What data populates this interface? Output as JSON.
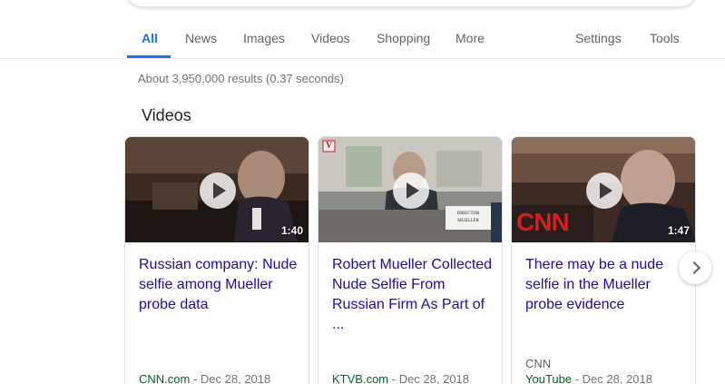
{
  "tabs": {
    "all": "All",
    "news": "News",
    "images": "Images",
    "videos": "Videos",
    "shopping": "Shopping",
    "more": "More",
    "settings": "Settings",
    "tools": "Tools",
    "active_color": "#1a73e8"
  },
  "result_stats": "About 3,950,000 results (0.37 seconds)",
  "videos_section": {
    "title": "Videos",
    "cards": [
      {
        "title": "Russian company: Nude selfie among Mueller probe data",
        "duration": "1:40",
        "publisher": "",
        "source": "CNN.com",
        "separator": " - ",
        "date": "Dec 28, 2018"
      },
      {
        "title": "Robert Mueller Collected Nude Selfie From Russian Firm As Part of ...",
        "duration": "",
        "overlay_logo": "V",
        "nameplate_line1": "DIRECTOR",
        "nameplate_line2": "MUELLER",
        "publisher": "",
        "source": "KTVB.com",
        "separator": " - ",
        "date": "Dec 28, 2018"
      },
      {
        "title": "There may be a nude selfie in the Mueller probe evidence",
        "duration": "1:47",
        "overlay_logo": "CNN",
        "publisher": "CNN",
        "source": "YouTube",
        "separator": " - ",
        "date": "Dec 28, 2018"
      }
    ]
  },
  "colors": {
    "link_title": "#1a0dab",
    "source_green": "#006621",
    "meta_gray": "#70757a"
  },
  "icons": {
    "play": "play-icon",
    "next": "chevron-right-icon"
  }
}
